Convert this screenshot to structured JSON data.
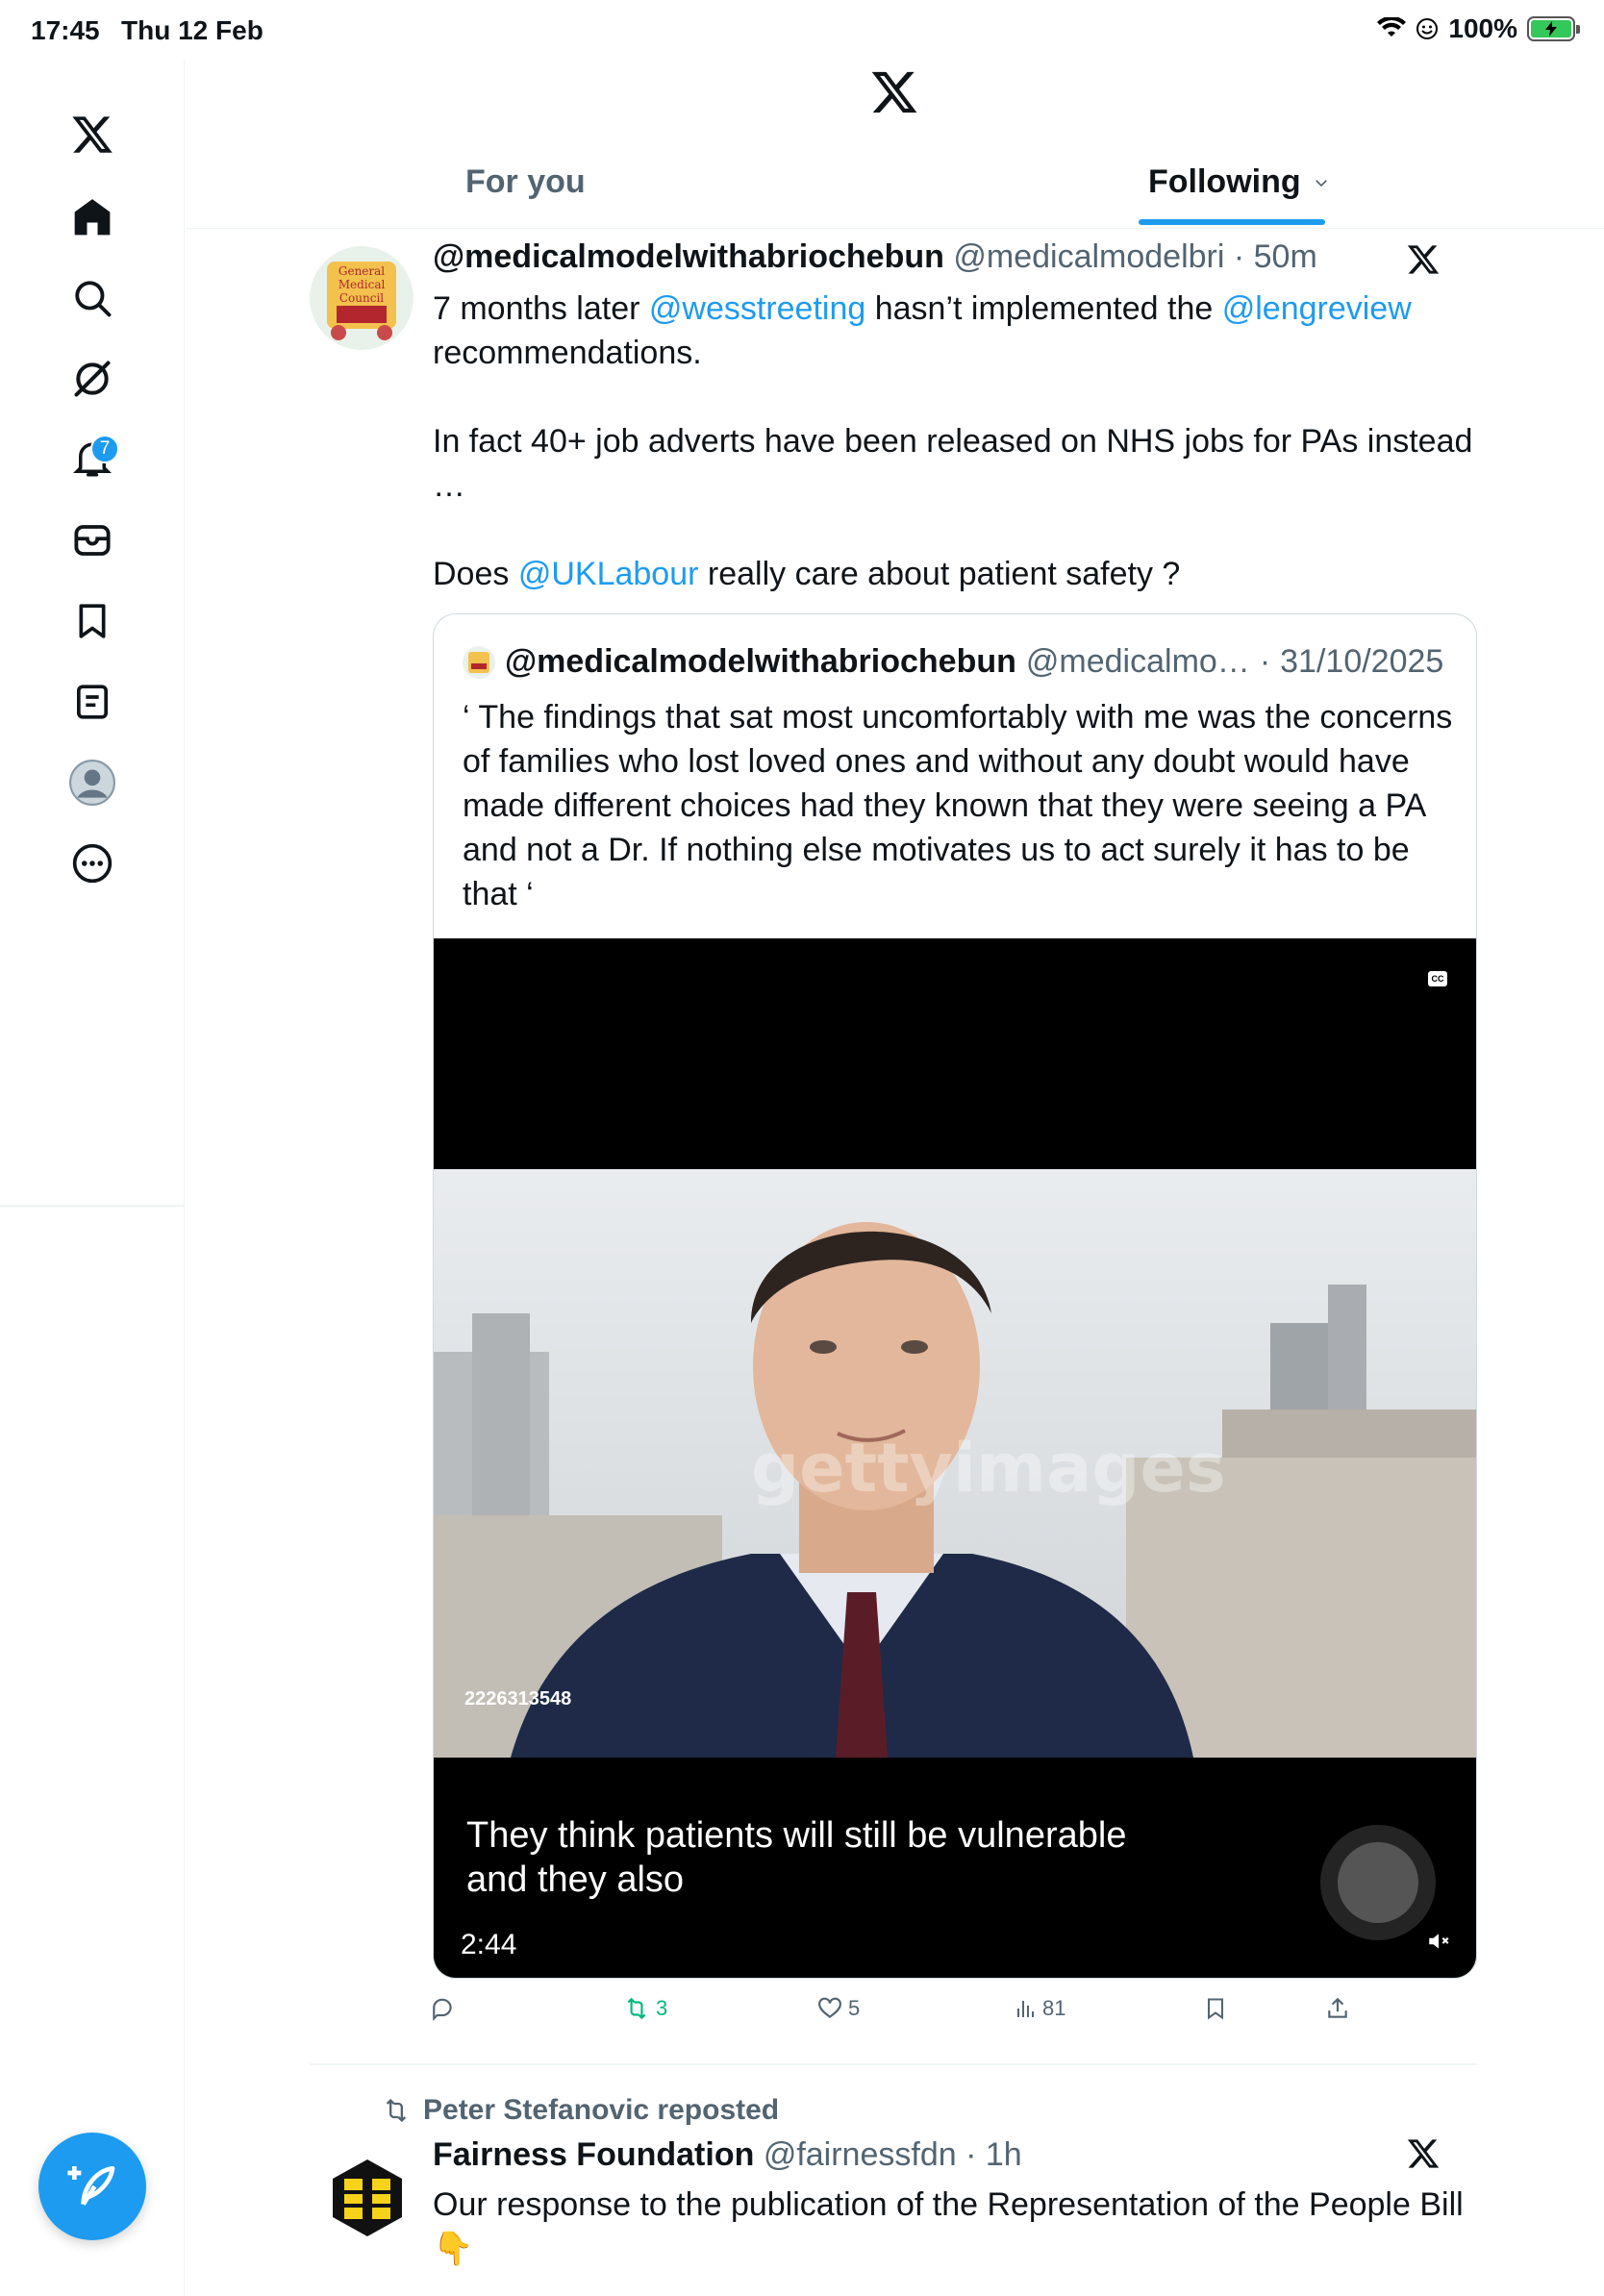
{
  "status_bar": {
    "time": "17:45",
    "date": "Thu 12 Feb",
    "battery": "100%"
  },
  "sidebar": {
    "items": [
      {
        "icon": "x-logo-icon"
      },
      {
        "icon": "home-icon"
      },
      {
        "icon": "search-icon"
      },
      {
        "icon": "grok-icon"
      },
      {
        "icon": "notifications-icon",
        "badge": "7"
      },
      {
        "icon": "messages-icon"
      },
      {
        "icon": "bookmarks-icon"
      },
      {
        "icon": "lists-icon"
      },
      {
        "icon": "profile-icon"
      },
      {
        "icon": "more-icon"
      }
    ],
    "compose_icon": "compose-icon"
  },
  "tabs": {
    "for_you": "For you",
    "following": "Following"
  },
  "tweet1": {
    "name": "@medicalmodelwithabriochebun",
    "handle": "@medicalmodelbri",
    "time": "50m",
    "text": {
      "p1_a": "7 months later ",
      "p1_link1": "@wesstreeting",
      "p1_b": " hasn’t implemented the ",
      "p1_link2": "@lengreview",
      "p1_c": " recommendations.",
      "p2": "In fact 40+ job adverts have been released on NHS jobs for PAs instead …",
      "p3_a": "Does ",
      "p3_link": "@UKLabour",
      "p3_b": " really care about patient safety ?"
    },
    "quote": {
      "name": "@medicalmodelwithabriochebun",
      "handle": "@medicalmo…",
      "date": "31/10/2025",
      "text": "‘ The findings that sat most uncomfortably with me was the concerns of families who lost loved ones and without any doubt would have made different choices had they known that they were seeing a PA and not a Dr. If nothing else motivates us to act surely it has to be that ‘",
      "video": {
        "watermark": "gettyimages",
        "image_id": "2226313548",
        "caption": "They think patients will still be vulnerable and they also",
        "duration": "2:44",
        "cc": "CC"
      }
    },
    "actions": {
      "replies": "",
      "reposts": "3",
      "likes": "5",
      "views": "81"
    }
  },
  "tweet2": {
    "repost_by": "Peter Stefanovic reposted",
    "name": "Fairness Foundation",
    "handle": "@fairnessfdn",
    "time": "1h",
    "text": "Our response to the publication of the Representation of the People Bill",
    "emoji": "👇"
  },
  "colors": {
    "accent": "#1d9bf0",
    "muted": "#536471",
    "repost_green": "#00ba7c",
    "border": "#cfd9de"
  }
}
